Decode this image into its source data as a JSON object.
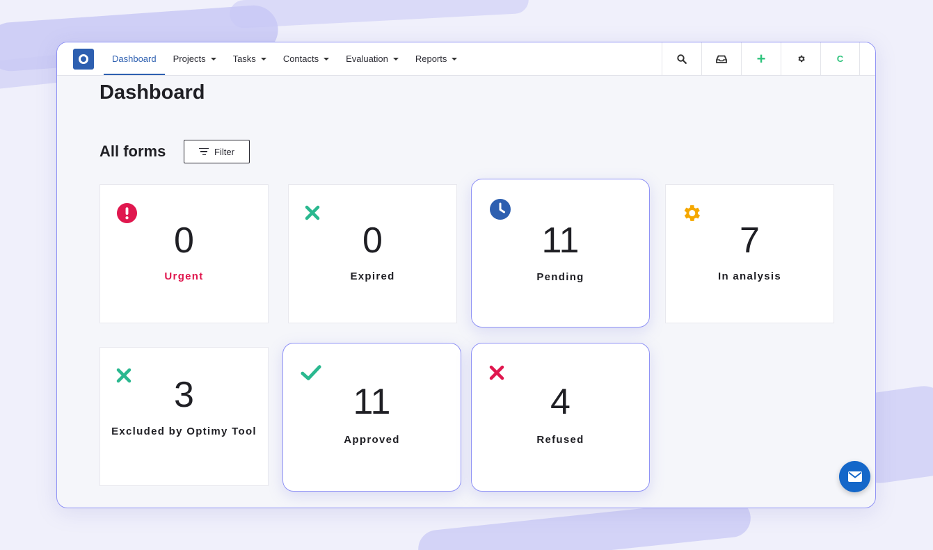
{
  "nav": {
    "items": [
      {
        "label": "Dashboard",
        "dropdown": false,
        "active": true
      },
      {
        "label": "Projects",
        "dropdown": true
      },
      {
        "label": "Tasks",
        "dropdown": true
      },
      {
        "label": "Contacts",
        "dropdown": true
      },
      {
        "label": "Evaluation",
        "dropdown": true
      },
      {
        "label": "Reports",
        "dropdown": true
      }
    ],
    "avatar_initial": "C"
  },
  "page": {
    "title": "Dashboard",
    "section_title": "All forms",
    "filter_label": "Filter"
  },
  "cards": [
    {
      "value": "0",
      "label": "Urgent",
      "icon": "exclamation-circle-icon",
      "color": "#e0174e"
    },
    {
      "value": "0",
      "label": "Expired",
      "icon": "cross-icon",
      "color": "#2ab88f"
    },
    {
      "value": "11",
      "label": "Pending",
      "icon": "clock-icon",
      "color": "#2d5fb0"
    },
    {
      "value": "7",
      "label": "In analysis",
      "icon": "gear-icon",
      "color": "#f5a800"
    },
    {
      "value": "3",
      "label": "Excluded by Optimy Tool",
      "icon": "cross-icon",
      "color": "#2ab88f"
    },
    {
      "value": "11",
      "label": "Approved",
      "icon": "check-icon",
      "color": "#2ab88f"
    },
    {
      "value": "4",
      "label": "Refused",
      "icon": "cross-icon",
      "color": "#e0174e"
    }
  ],
  "colors": {
    "brand": "#2d5fb0",
    "accent_border": "#8f92f5",
    "add": "#2ec37c",
    "chat": "#1467c9"
  }
}
